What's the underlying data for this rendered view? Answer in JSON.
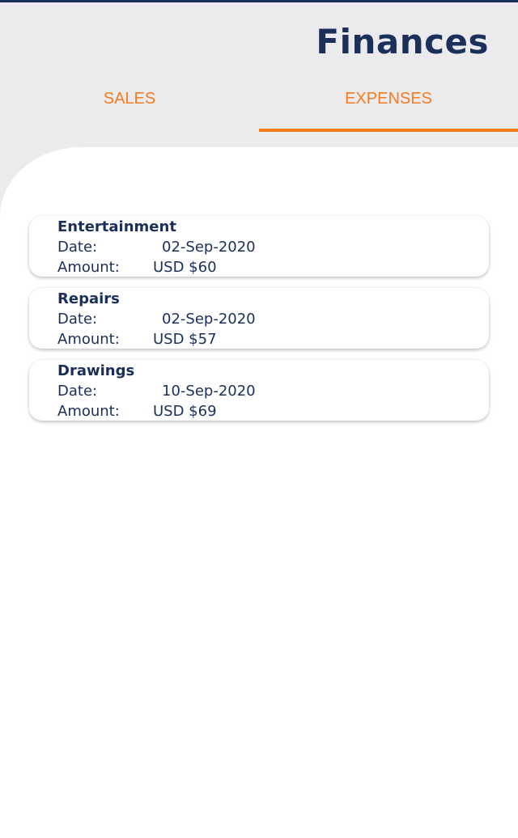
{
  "header": {
    "title": "Finances"
  },
  "tabs": [
    {
      "label": "SALES",
      "active": false
    },
    {
      "label": "EXPENSES",
      "active": true
    }
  ],
  "colors": {
    "primary": "#1b2f5b",
    "accent": "#f57c1f",
    "header_bg": "#ebebed"
  },
  "expenses": [
    {
      "title": "Entertainment",
      "date_label": "Date:",
      "date": "02-Sep-2020",
      "amount_label": "Amount:",
      "amount": "USD $60"
    },
    {
      "title": "Repairs",
      "date_label": "Date:",
      "date": "02-Sep-2020",
      "amount_label": "Amount:",
      "amount": "USD $57"
    },
    {
      "title": "Drawings",
      "date_label": "Date:",
      "date": "10-Sep-2020",
      "amount_label": "Amount:",
      "amount": "USD $69"
    }
  ]
}
